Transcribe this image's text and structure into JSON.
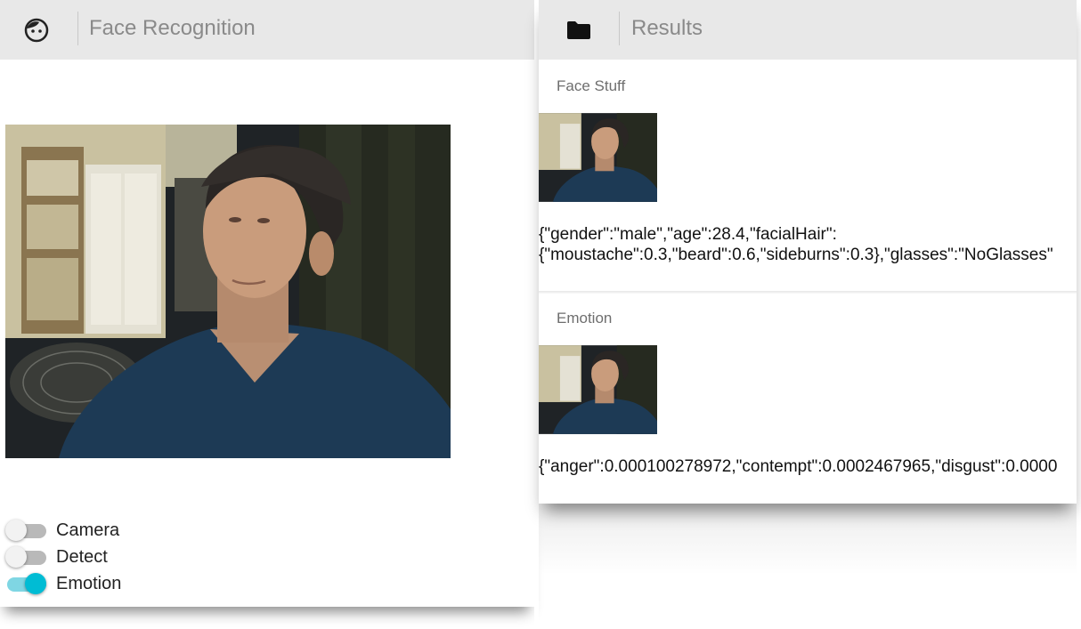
{
  "left_panel": {
    "title": "Face Recognition",
    "icon": "face-icon",
    "toggles": [
      {
        "label": "Camera",
        "checked": false
      },
      {
        "label": "Detect",
        "checked": false
      },
      {
        "label": "Emotion",
        "checked": true
      }
    ]
  },
  "right_panel": {
    "title": "Results",
    "icon": "folder-icon",
    "cards": [
      {
        "title": "Face Stuff",
        "lines": [
          "{\"gender\":\"male\",\"age\":28.4,\"facialHair\":",
          "{\"moustache\":0.3,\"beard\":0.6,\"sideburns\":0.3},\"glasses\":\"NoGlasses\""
        ]
      },
      {
        "title": "Emotion",
        "lines": [
          "{\"anger\":0.000100278972,\"contempt\":0.0002467965,\"disgust\":0.0000"
        ]
      }
    ]
  },
  "colors": {
    "accent": "#00bcd4",
    "toolbar": "#e8e8e8"
  }
}
